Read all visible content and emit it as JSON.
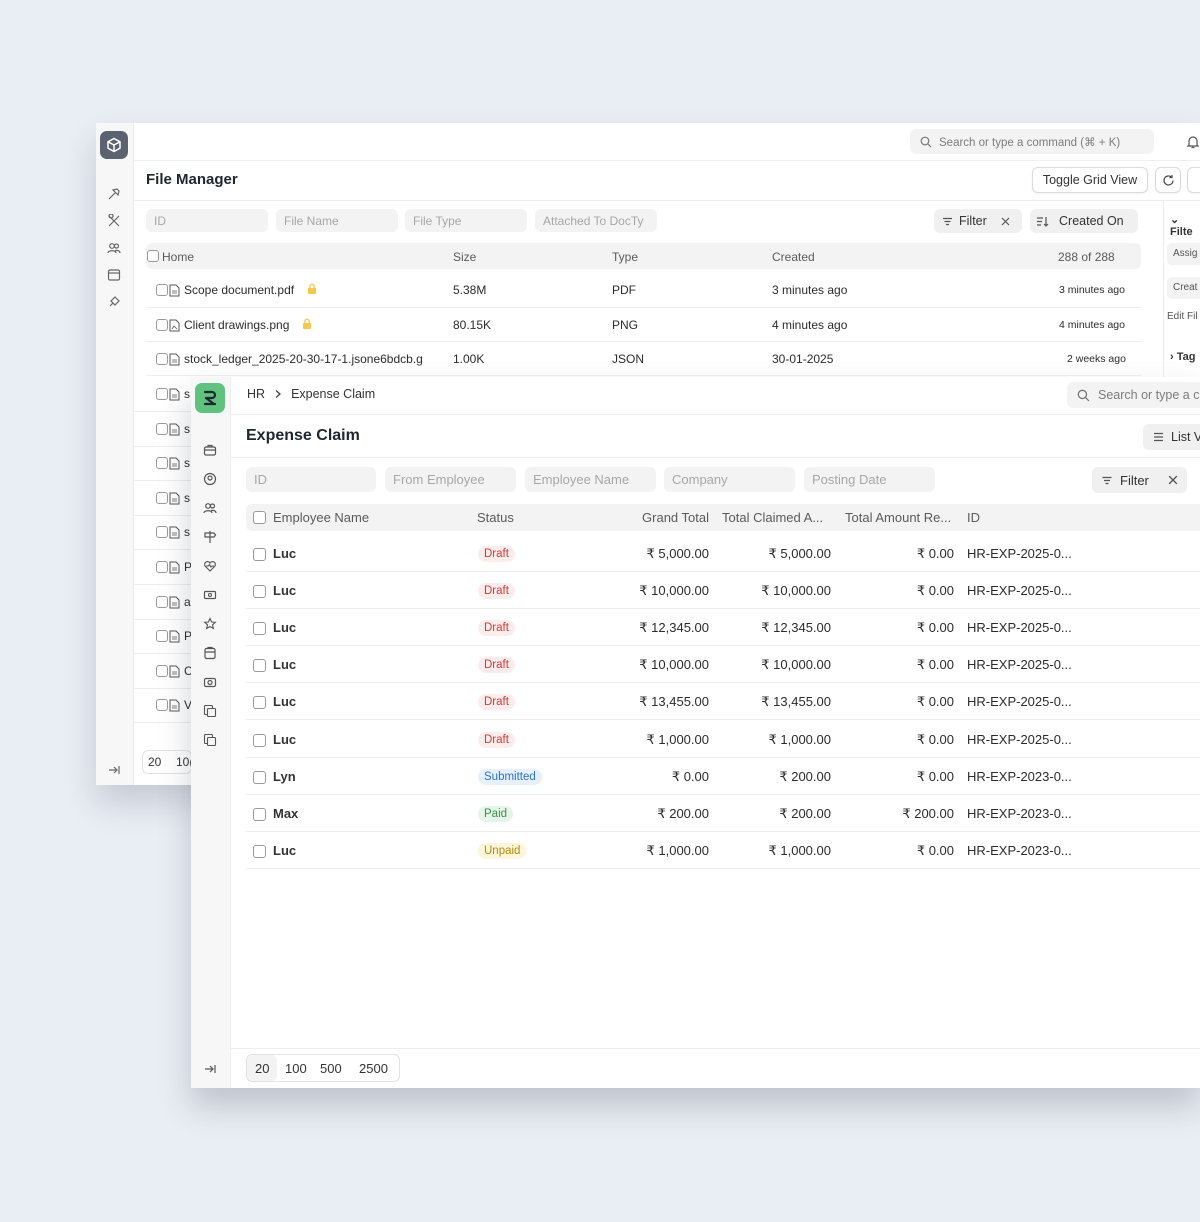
{
  "back": {
    "search_placeholder": "Search or type a command (⌘ + K)",
    "title": "File Manager",
    "toggle_grid": "Toggle Grid View",
    "filters": [
      "ID",
      "File Name",
      "File Type",
      "Attached To DocTy"
    ],
    "filter_label": "Filter",
    "sort_label": "Created On",
    "columns": [
      "Home",
      "Size",
      "Type",
      "Created"
    ],
    "count": "288 of 288",
    "rows": [
      {
        "name": "Scope document.pdf",
        "size": "5.38M",
        "type": "PDF",
        "created": "3 minutes ago",
        "modified": "3 minutes ago"
      },
      {
        "name": "Client drawings.png",
        "size": "80.15K",
        "type": "PNG",
        "created": "4 minutes ago",
        "modified": "4 minutes ago"
      },
      {
        "name": "stock_ledger_2025-20-30-17-1.jsone6bdcb.g",
        "size": "1.00K",
        "type": "JSON",
        "created": "30-01-2025",
        "modified": "2 weeks ago"
      }
    ],
    "hidden_initials": [
      "s",
      "s",
      "s",
      "s",
      "s",
      "P",
      "a",
      "P",
      "C",
      "V"
    ],
    "page_sizes": [
      "20",
      "10("
    ],
    "side_panel": {
      "filter": "Filte",
      "assign": "Assig",
      "created": "Creat",
      "edit": "Edit Fil",
      "tags": "Tag"
    }
  },
  "front": {
    "breadcrumb": [
      "HR",
      "Expense Claim"
    ],
    "search_placeholder": "Search or type a c",
    "title": "Expense Claim",
    "list_view": "List V",
    "filters": [
      "ID",
      "From Employee",
      "Employee Name",
      "Company",
      "Posting Date"
    ],
    "filter_label": "Filter",
    "columns": [
      "Employee Name",
      "Status",
      "Grand Total",
      "Total Claimed A...",
      "Total Amount Re...",
      "ID"
    ],
    "rows": [
      {
        "name": "Luc",
        "status": "Draft",
        "status_kind": "draft",
        "grand": "₹ 5,000.00",
        "claimed": "₹ 5,000.00",
        "reimbursed": "₹ 0.00",
        "id": "HR-EXP-2025-0..."
      },
      {
        "name": "Luc",
        "status": "Draft",
        "status_kind": "draft",
        "grand": "₹ 10,000.00",
        "claimed": "₹ 10,000.00",
        "reimbursed": "₹ 0.00",
        "id": "HR-EXP-2025-0..."
      },
      {
        "name": "Luc",
        "status": "Draft",
        "status_kind": "draft",
        "grand": "₹ 12,345.00",
        "claimed": "₹ 12,345.00",
        "reimbursed": "₹ 0.00",
        "id": "HR-EXP-2025-0..."
      },
      {
        "name": "Luc",
        "status": "Draft",
        "status_kind": "draft",
        "grand": "₹ 10,000.00",
        "claimed": "₹ 10,000.00",
        "reimbursed": "₹ 0.00",
        "id": "HR-EXP-2025-0..."
      },
      {
        "name": "Luc",
        "status": "Draft",
        "status_kind": "draft",
        "grand": "₹ 13,455.00",
        "claimed": "₹ 13,455.00",
        "reimbursed": "₹ 0.00",
        "id": "HR-EXP-2025-0..."
      },
      {
        "name": "Luc",
        "status": "Draft",
        "status_kind": "draft",
        "grand": "₹ 1,000.00",
        "claimed": "₹ 1,000.00",
        "reimbursed": "₹ 0.00",
        "id": "HR-EXP-2025-0..."
      },
      {
        "name": "Lyn",
        "status": "Submitted",
        "status_kind": "submitted",
        "grand": "₹ 0.00",
        "claimed": "₹ 200.00",
        "reimbursed": "₹ 0.00",
        "id": "HR-EXP-2023-0..."
      },
      {
        "name": "Max",
        "status": "Paid",
        "status_kind": "paid",
        "grand": "₹ 200.00",
        "claimed": "₹ 200.00",
        "reimbursed": "₹ 200.00",
        "id": "HR-EXP-2023-0..."
      },
      {
        "name": "Luc",
        "status": "Unpaid",
        "status_kind": "unpaid",
        "grand": "₹ 1,000.00",
        "claimed": "₹ 1,000.00",
        "reimbursed": "₹ 0.00",
        "id": "HR-EXP-2023-0..."
      }
    ],
    "page_sizes": [
      "20",
      "100",
      "500",
      "2500"
    ]
  },
  "colors": {
    "draft": "#c7403b",
    "submitted": "#2f72c9",
    "paid": "#3b9150",
    "unpaid": "#b58a0f",
    "logo_green": "#5fc27e"
  }
}
